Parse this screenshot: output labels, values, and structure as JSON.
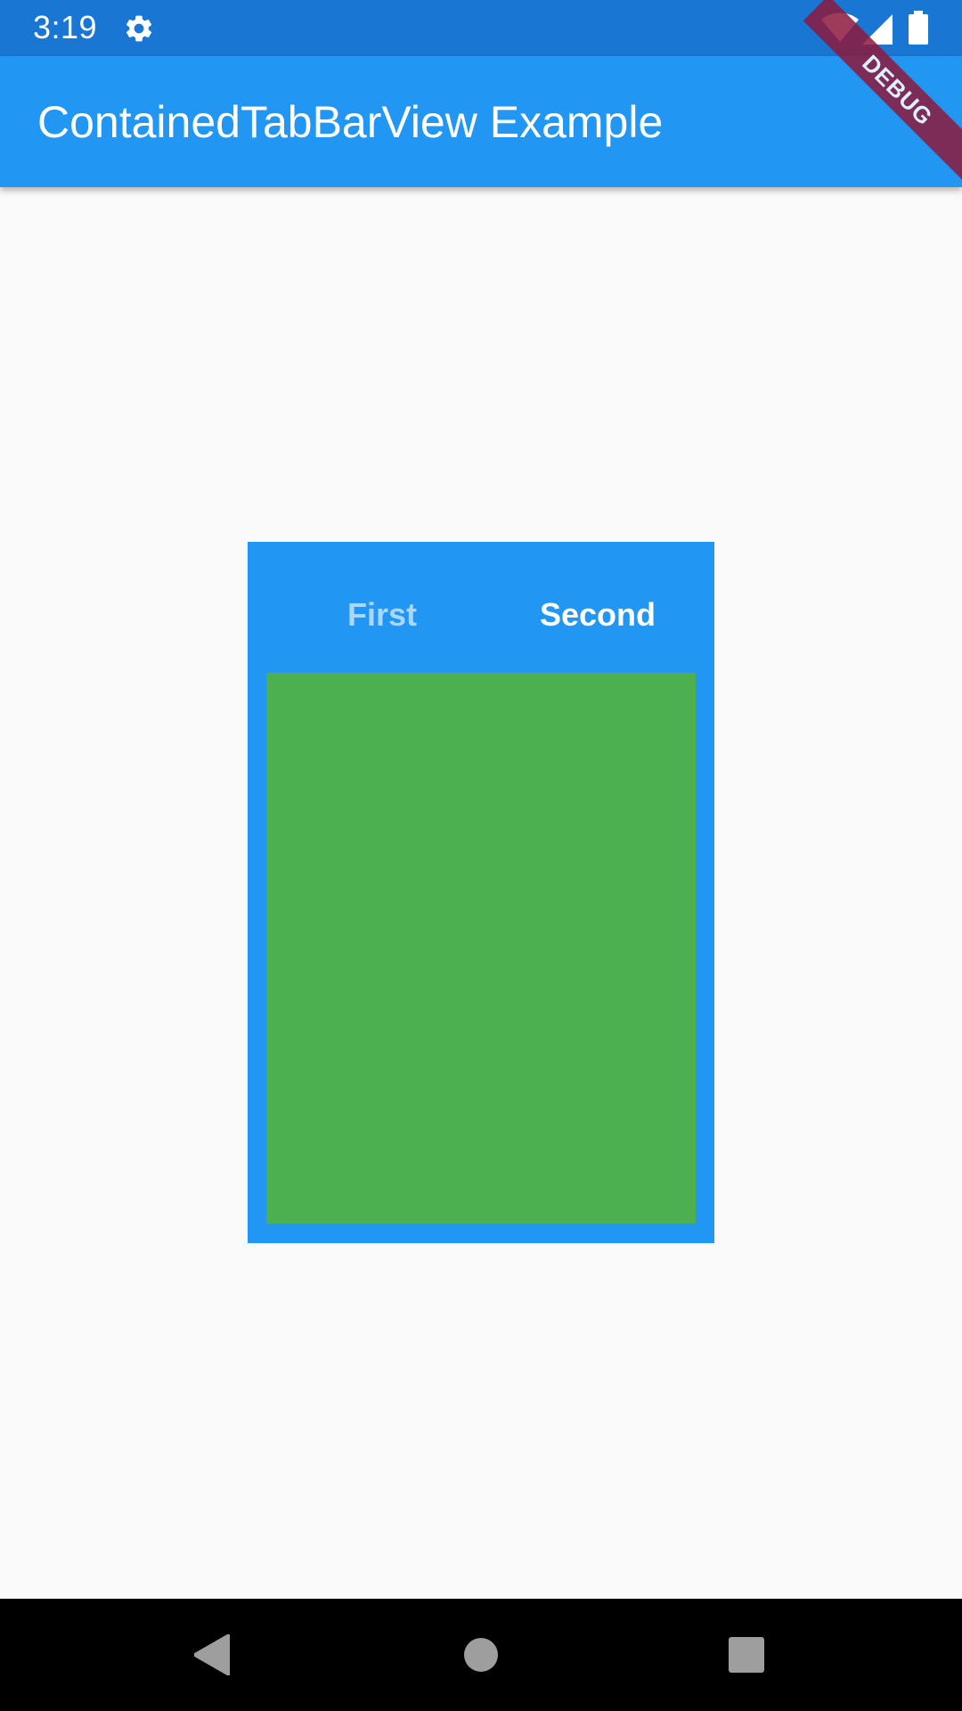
{
  "status_bar": {
    "time": "3:19",
    "settings_icon": "gear-icon",
    "wifi_icon": "wifi-icon",
    "signal_icon": "cell-signal-icon",
    "battery_icon": "battery-icon"
  },
  "app_bar": {
    "title": "ContainedTabBarView Example"
  },
  "debug_banner": {
    "label": "DEBUG"
  },
  "tabs": [
    {
      "label": "First",
      "selected": false
    },
    {
      "label": "Second",
      "selected": true
    }
  ],
  "nav_bar": {
    "back_icon": "back-triangle-icon",
    "home_icon": "home-circle-icon",
    "recents_icon": "recents-square-icon"
  },
  "colors": {
    "status_bar": "#1976d2",
    "app_bar": "#2196f3",
    "tab_container": "#2196f3",
    "tab_panel": "#4caf50",
    "background": "#fafafa",
    "nav_bar": "#000000",
    "debug_banner": "#8e1a3e"
  }
}
